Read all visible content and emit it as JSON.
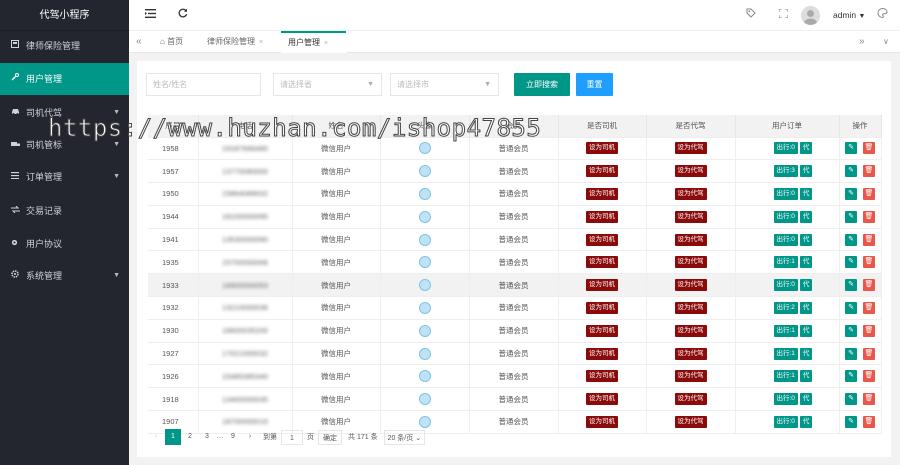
{
  "app": {
    "title": "代驾小程序"
  },
  "sidebar": {
    "items": [
      {
        "label": "律师保险管理",
        "icon": "board-icon",
        "arrow": false,
        "active": false
      },
      {
        "label": "用户管理",
        "icon": "wrench-icon",
        "arrow": false,
        "active": true
      },
      {
        "label": "司机代驾",
        "icon": "car-icon",
        "arrow": true,
        "active": false
      },
      {
        "label": "司机管标",
        "icon": "truck-icon",
        "arrow": true,
        "active": false
      },
      {
        "label": "订单管理",
        "icon": "list-icon",
        "arrow": true,
        "active": false
      },
      {
        "label": "交易记录",
        "icon": "exchange-icon",
        "arrow": false,
        "active": false
      },
      {
        "label": "用户协议",
        "icon": "gear-small-icon",
        "arrow": false,
        "active": false
      },
      {
        "label": "系统管理",
        "icon": "cog-icon",
        "arrow": true,
        "active": false
      }
    ]
  },
  "header": {
    "user": "admin"
  },
  "tabs": {
    "home": "首页",
    "tab1": "律师保险管理",
    "tab2": "用户管理"
  },
  "filters": {
    "name_placeholder": "姓名/姓名",
    "province_placeholder": "请选择省",
    "city_placeholder": "请选择市",
    "search_label": "立即搜索",
    "reset_label": "重置"
  },
  "table": {
    "headers": [
      "序号",
      "电话",
      "姓名",
      "头像",
      "会员",
      "是否司机",
      "是否代驾",
      "用户订单",
      "操作"
    ],
    "rows": [
      {
        "id": "1958",
        "phone": "19187666480",
        "name": "微信用户",
        "member": "普通会员",
        "is_driver": "设为司机",
        "is_valet": "设为代驾",
        "order_count": "出行:0",
        "highlight": false
      },
      {
        "id": "1957",
        "phone": "13770080000",
        "name": "微信用户",
        "member": "普通会员",
        "is_driver": "设为司机",
        "is_valet": "设为代驾",
        "order_count": "出行:3",
        "highlight": false
      },
      {
        "id": "1950",
        "phone": "15864089932",
        "name": "微信用户",
        "member": "普通会员",
        "is_driver": "设为司机",
        "is_valet": "设为代驾",
        "order_count": "出行:0",
        "highlight": false
      },
      {
        "id": "1944",
        "phone": "18100000095",
        "name": "微信用户",
        "member": "普通会员",
        "is_driver": "设为司机",
        "is_valet": "设为代驾",
        "order_count": "出行:0",
        "highlight": false
      },
      {
        "id": "1941",
        "phone": "13530000090",
        "name": "微信用户",
        "member": "普通会员",
        "is_driver": "设为司机",
        "is_valet": "设为代驾",
        "order_count": "出行:0",
        "highlight": false
      },
      {
        "id": "1935",
        "phone": "15700000066",
        "name": "微信用户",
        "member": "普通会员",
        "is_driver": "设为司机",
        "is_valet": "设为代驾",
        "order_count": "出行:1",
        "highlight": false
      },
      {
        "id": "1933",
        "phone": "18900000053",
        "name": "微信用户",
        "member": "普通会员",
        "is_driver": "设为司机",
        "is_valet": "设为代驾",
        "order_count": "出行:0",
        "highlight": true
      },
      {
        "id": "1932",
        "phone": "13210000036",
        "name": "微信用户",
        "member": "普通会员",
        "is_driver": "设为司机",
        "is_valet": "设为代驾",
        "order_count": "出行:2",
        "highlight": false
      },
      {
        "id": "1930",
        "phone": "16600035200",
        "name": "微信用户",
        "member": "普通会员",
        "is_driver": "设为司机",
        "is_valet": "设为代驾",
        "order_count": "出行:1",
        "highlight": false
      },
      {
        "id": "1927",
        "phone": "17021000032",
        "name": "微信用户",
        "member": "普通会员",
        "is_driver": "设为司机",
        "is_valet": "设为代驾",
        "order_count": "出行:1",
        "highlight": false
      },
      {
        "id": "1926",
        "phone": "15485385340",
        "name": "微信用户",
        "member": "普通会员",
        "is_driver": "设为司机",
        "is_valet": "设为代驾",
        "order_count": "出行:1",
        "highlight": false
      },
      {
        "id": "1918",
        "phone": "13400000035",
        "name": "微信用户",
        "member": "普通会员",
        "is_driver": "设为司机",
        "is_valet": "设为代驾",
        "order_count": "出行:0",
        "highlight": false
      },
      {
        "id": "1907",
        "phone": "18700000010",
        "name": "微信用户",
        "member": "普通会员",
        "is_driver": "设为司机",
        "is_valet": "设为代驾",
        "order_count": "出行:0",
        "highlight": false
      }
    ],
    "order_extra": "代"
  },
  "pagination": {
    "pages": [
      "1",
      "2",
      "3",
      "…",
      "9"
    ],
    "goto_label": "到第",
    "goto_value": "1",
    "page_unit": "页",
    "confirm": "确定",
    "total": "共 171 条",
    "per_page": "20 条/页"
  },
  "watermark": "https://www.huzhan.com/ishop47855",
  "colors": {
    "accent": "#009688",
    "sidebar_bg": "#23262e",
    "danger_badge": "#8b0a0a",
    "delete": "#e8574a",
    "reset": "#1e9fff"
  }
}
